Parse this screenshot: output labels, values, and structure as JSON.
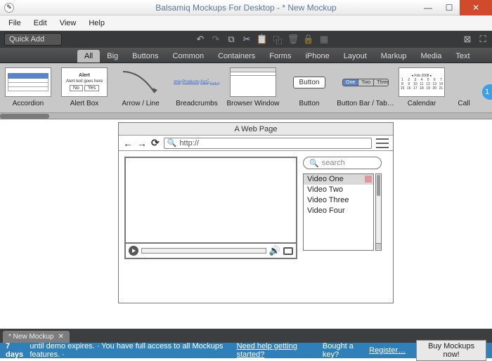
{
  "window": {
    "title": "Balsamiq Mockups For Desktop - * New Mockup"
  },
  "menu": [
    "File",
    "Edit",
    "View",
    "Help"
  ],
  "quickadd": "Quick Add",
  "library_categories": [
    "All",
    "Big",
    "Buttons",
    "Common",
    "Containers",
    "Forms",
    "iPhone",
    "Layout",
    "Markup",
    "Media",
    "Text"
  ],
  "active_category": "All",
  "library_items": [
    {
      "label": "Accordion"
    },
    {
      "label": "Alert Box"
    },
    {
      "label": "Arrow / Line"
    },
    {
      "label": "Breadcrumbs"
    },
    {
      "label": "Browser Window"
    },
    {
      "label": "Button"
    },
    {
      "label": "Button Bar / Tab…"
    },
    {
      "label": "Calendar"
    },
    {
      "label": "Call"
    }
  ],
  "badge": "1",
  "mock": {
    "title": "A Web Page",
    "url_prefix": "http://",
    "search_placeholder": "search",
    "videos": [
      "Video One",
      "Video Two",
      "Video Three",
      "Video Four"
    ],
    "selected_index": 0
  },
  "doctab": {
    "name": "* New Mockup",
    "close": "✕"
  },
  "status": {
    "days": "7 days",
    "msg1": " until demo expires.  ·  You have full access to all Mockups features.  ·  ",
    "help": "Need help getting started?",
    "bought": "Bought a key? ",
    "register": "Register…",
    "buy": "Buy Mockups now!"
  }
}
